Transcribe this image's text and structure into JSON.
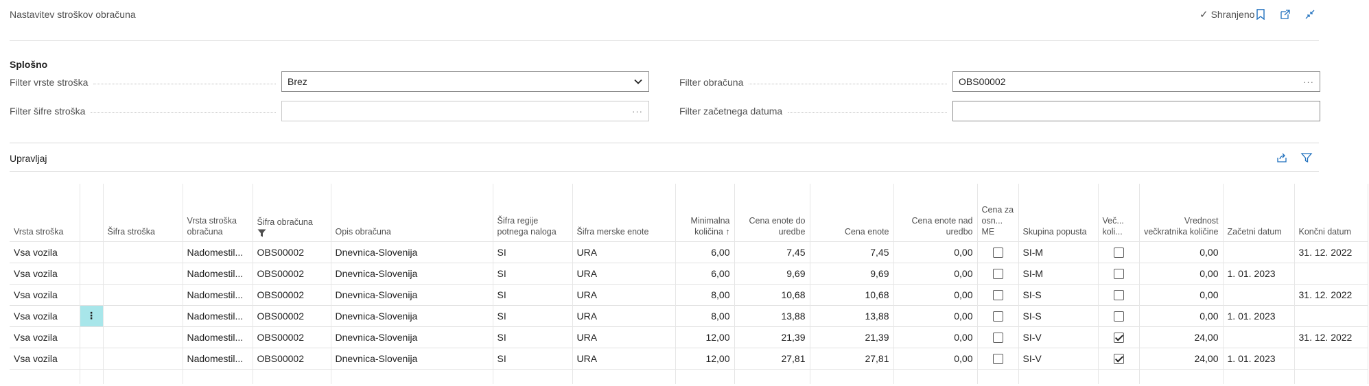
{
  "header": {
    "title": "Nastavitev stroškov obračuna",
    "saved_label": "Shranjeno"
  },
  "general": {
    "title": "Splošno",
    "cost_type_filter_label": "Filter vrste stroška",
    "cost_type_filter_value": "Brez",
    "cost_code_filter_label": "Filter šifre stroška",
    "cost_code_filter_value": "",
    "settlement_filter_label": "Filter obračuna",
    "settlement_filter_value": "OBS00002",
    "start_date_filter_label": "Filter začetnega datuma",
    "start_date_filter_value": ""
  },
  "manage": {
    "label": "Upravljaj"
  },
  "table": {
    "columns": [
      {
        "label": "Vrsta stroška"
      },
      {
        "label": ""
      },
      {
        "label": "Šifra stroška"
      },
      {
        "label": "Vrsta stroška obračuna"
      },
      {
        "label": "Šifra obračuna"
      },
      {
        "label": "Opis obračuna"
      },
      {
        "label": "Šifra regije potnega naloga"
      },
      {
        "label": "Šifra merske enote"
      },
      {
        "label": "Minimalna količina ↑"
      },
      {
        "label": "Cena enote do uredbe"
      },
      {
        "label": "Cena enote"
      },
      {
        "label": "Cena enote nad uredbo"
      },
      {
        "label": "Cena za osn... ME"
      },
      {
        "label": "Skupina popusta"
      },
      {
        "label": "Več... koli..."
      },
      {
        "label": "Vrednost večkratnika količine"
      },
      {
        "label": "Začetni datum"
      },
      {
        "label": "Končni datum"
      }
    ],
    "rows": [
      {
        "vrsta": "Vsa vozila",
        "sifra_stroska": "",
        "vrsta_obr": "Nadomestil...",
        "sifra_obr": "OBS00002",
        "opis": "Dnevnica-Slovenija",
        "regija": "SI",
        "me": "URA",
        "min_kol": "6,00",
        "cena_do": "7,45",
        "cena": "7,45",
        "cena_nad": "0,00",
        "osn_me": false,
        "skupina": "SI-M",
        "vec": false,
        "vrednost": "0,00",
        "zacetni": "",
        "koncni": "31. 12. 2022"
      },
      {
        "vrsta": "Vsa vozila",
        "sifra_stroska": "",
        "vrsta_obr": "Nadomestil...",
        "sifra_obr": "OBS00002",
        "opis": "Dnevnica-Slovenija",
        "regija": "SI",
        "me": "URA",
        "min_kol": "6,00",
        "cena_do": "9,69",
        "cena": "9,69",
        "cena_nad": "0,00",
        "osn_me": false,
        "skupina": "SI-M",
        "vec": false,
        "vrednost": "0,00",
        "zacetni": "1. 01. 2023",
        "koncni": ""
      },
      {
        "vrsta": "Vsa vozila",
        "sifra_stroska": "",
        "vrsta_obr": "Nadomestil...",
        "sifra_obr": "OBS00002",
        "opis": "Dnevnica-Slovenija",
        "regija": "SI",
        "me": "URA",
        "min_kol": "8,00",
        "cena_do": "10,68",
        "cena": "10,68",
        "cena_nad": "0,00",
        "osn_me": false,
        "skupina": "SI-S",
        "vec": false,
        "vrednost": "0,00",
        "zacetni": "",
        "koncni": "31. 12. 2022"
      },
      {
        "vrsta": "Vsa vozila",
        "sifra_stroska": "",
        "vrsta_obr": "Nadomestil...",
        "sifra_obr": "OBS00002",
        "opis": "Dnevnica-Slovenija",
        "regija": "SI",
        "me": "URA",
        "min_kol": "8,00",
        "cena_do": "13,88",
        "cena": "13,88",
        "cena_nad": "0,00",
        "osn_me": false,
        "skupina": "SI-S",
        "vec": false,
        "vrednost": "0,00",
        "zacetni": "1. 01. 2023",
        "koncni": ""
      },
      {
        "vrsta": "Vsa vozila",
        "sifra_stroska": "",
        "vrsta_obr": "Nadomestil...",
        "sifra_obr": "OBS00002",
        "opis": "Dnevnica-Slovenija",
        "regija": "SI",
        "me": "URA",
        "min_kol": "12,00",
        "cena_do": "21,39",
        "cena": "21,39",
        "cena_nad": "0,00",
        "osn_me": false,
        "skupina": "SI-V",
        "vec": true,
        "vrednost": "24,00",
        "zacetni": "",
        "koncni": "31. 12. 2022"
      },
      {
        "vrsta": "Vsa vozila",
        "sifra_stroska": "",
        "vrsta_obr": "Nadomestil...",
        "sifra_obr": "OBS00002",
        "opis": "Dnevnica-Slovenija",
        "regija": "SI",
        "me": "URA",
        "min_kol": "12,00",
        "cena_do": "27,81",
        "cena": "27,81",
        "cena_nad": "0,00",
        "osn_me": false,
        "skupina": "SI-V",
        "vec": true,
        "vrednost": "24,00",
        "zacetni": "1. 01. 2023",
        "koncni": ""
      }
    ],
    "selected_row": 3,
    "row_menu_glyph": "⋮"
  },
  "icons": {
    "saved": "check-icon",
    "bookmark": "bookmark-icon",
    "open_new": "open-in-new-window-icon",
    "collapse": "collapse-icon",
    "share": "share-icon",
    "filter": "filter-icon",
    "dropdown": "chevron-down-icon",
    "lookup": "more-icon",
    "row_menu": "row-menu-icon"
  },
  "colors": {
    "accent": "#1e6fbd",
    "selected_cell": "#a8e6ea",
    "label_text": "#505050"
  }
}
